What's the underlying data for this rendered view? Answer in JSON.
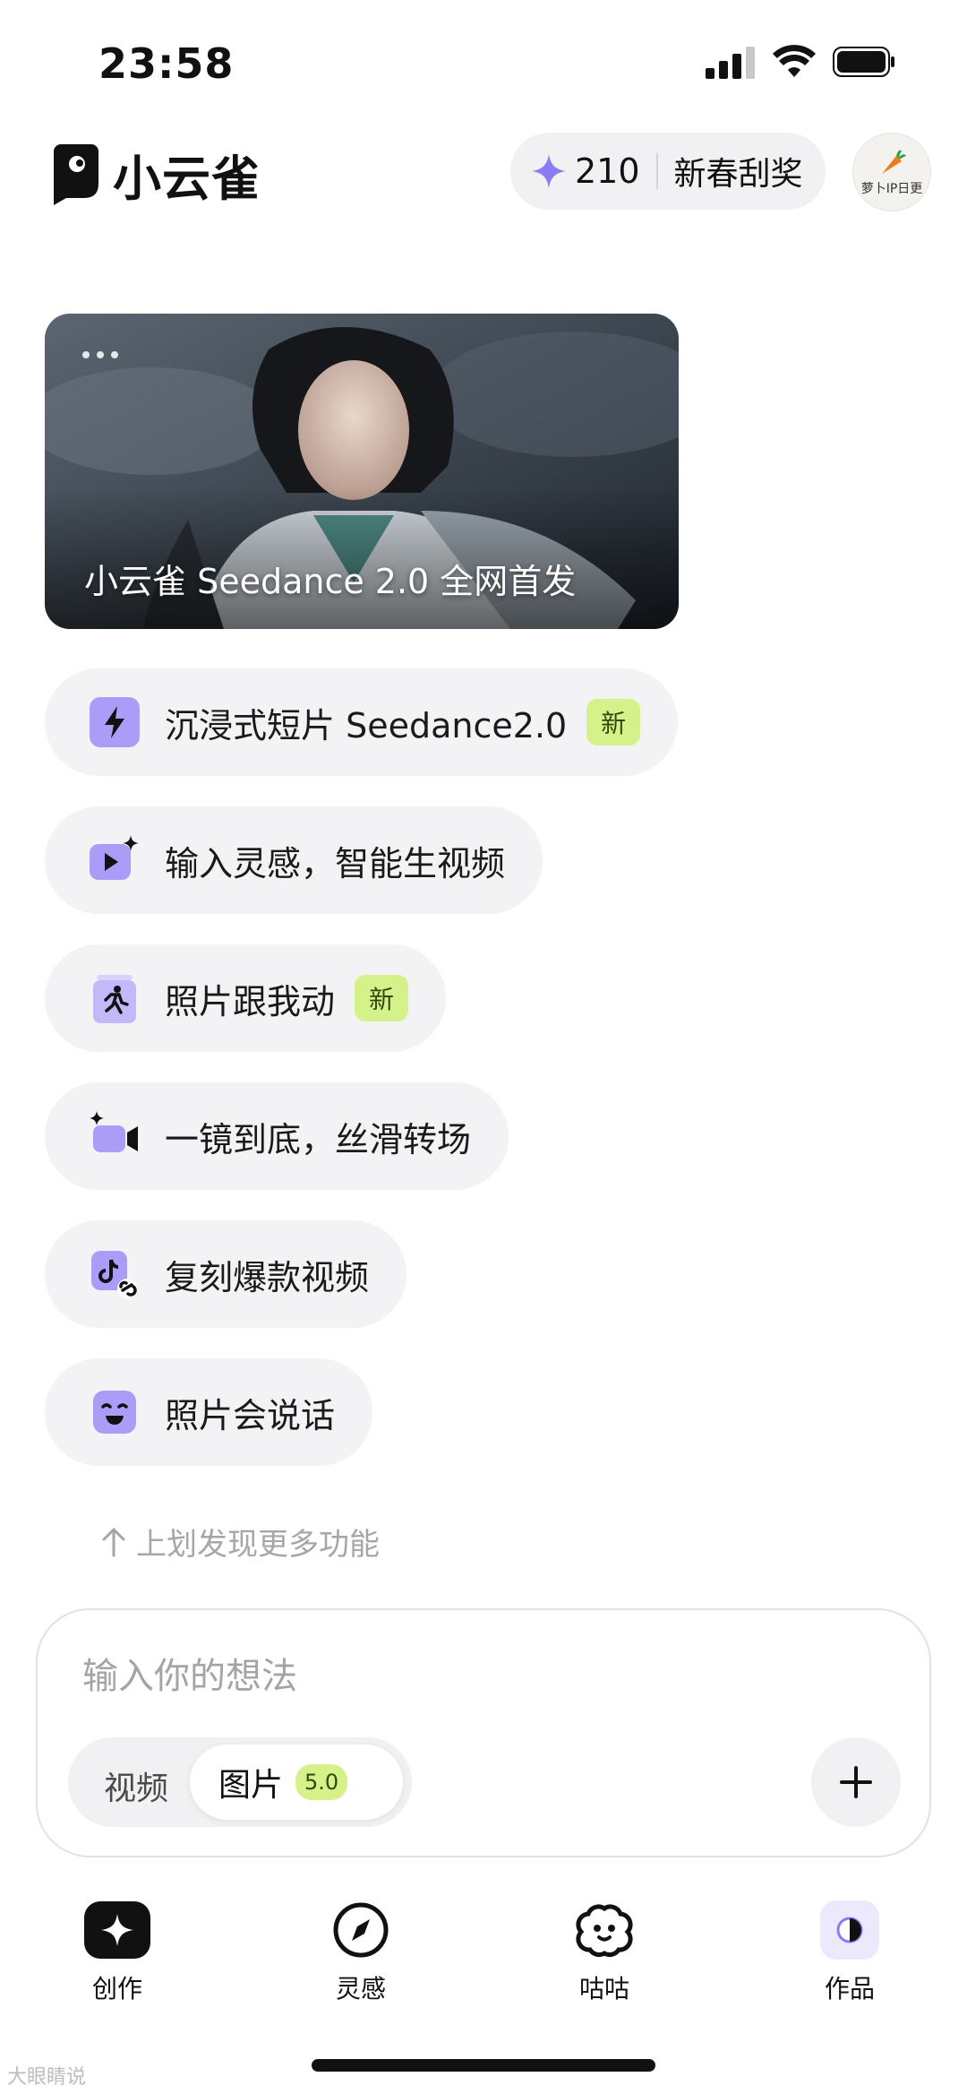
{
  "status_bar": {
    "time": "23:58"
  },
  "header": {
    "app_name": "小云雀",
    "points": "210",
    "promo_label": "新春刮奖",
    "avatar_text": "萝卜IP日更"
  },
  "banner": {
    "caption": "小云雀 Seedance 2.0 全网首发"
  },
  "features": [
    {
      "label": "沉浸式短片 Seedance2.0",
      "badge": "新",
      "icon": "lightning-icon"
    },
    {
      "label": "输入灵感，智能生视频",
      "icon": "video-sparkle-icon"
    },
    {
      "label": "照片跟我动",
      "badge": "新",
      "icon": "running-figure-icon"
    },
    {
      "label": "一镜到底，丝滑转场",
      "icon": "camera-sparkle-icon"
    },
    {
      "label": "复刻爆款视频",
      "icon": "tiktok-link-icon"
    },
    {
      "label": "照片会说话",
      "icon": "talking-face-icon"
    }
  ],
  "hint": "上划发现更多功能",
  "composer": {
    "placeholder": "输入你的想法",
    "mode_video": "视频",
    "mode_image": "图片",
    "image_version": "5.0"
  },
  "nav": [
    {
      "label": "创作",
      "icon": "sparkle-icon",
      "active": true
    },
    {
      "label": "灵感",
      "icon": "compass-icon"
    },
    {
      "label": "咕咕",
      "icon": "cloud-face-icon"
    },
    {
      "label": "作品",
      "icon": "half-moon-icon"
    }
  ],
  "watermark": "大眼睛说",
  "colors": {
    "accent_purple": "#8b7cf6",
    "badge_green": "#d5f28a",
    "pill_bg": "#f3f3f5"
  }
}
